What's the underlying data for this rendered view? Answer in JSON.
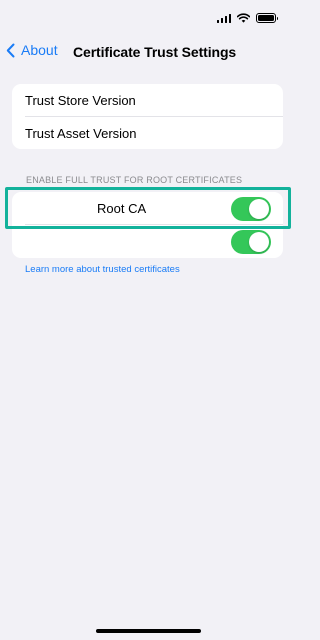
{
  "status_bar": {
    "icons": [
      "cellular-signal-icon",
      "wifi-icon",
      "battery-icon"
    ]
  },
  "nav": {
    "back_label": "About",
    "title": "Certificate Trust Settings",
    "back_icon": "chevron-left-icon"
  },
  "info_rows": [
    {
      "label": "Trust Store Version"
    },
    {
      "label": "Trust Asset Version"
    }
  ],
  "trust_section": {
    "header": "ENABLE FULL TRUST FOR ROOT CERTIFICATES",
    "rows": [
      {
        "label": "Root CA",
        "enabled": true
      },
      {
        "label": "",
        "enabled": true
      }
    ]
  },
  "learn_more_link": "Learn more about trusted certificates",
  "colors": {
    "accent": "#1a7cf6",
    "toggle_on": "#34c759",
    "background": "#f2f1f6",
    "highlight_box": "#13b29b"
  }
}
